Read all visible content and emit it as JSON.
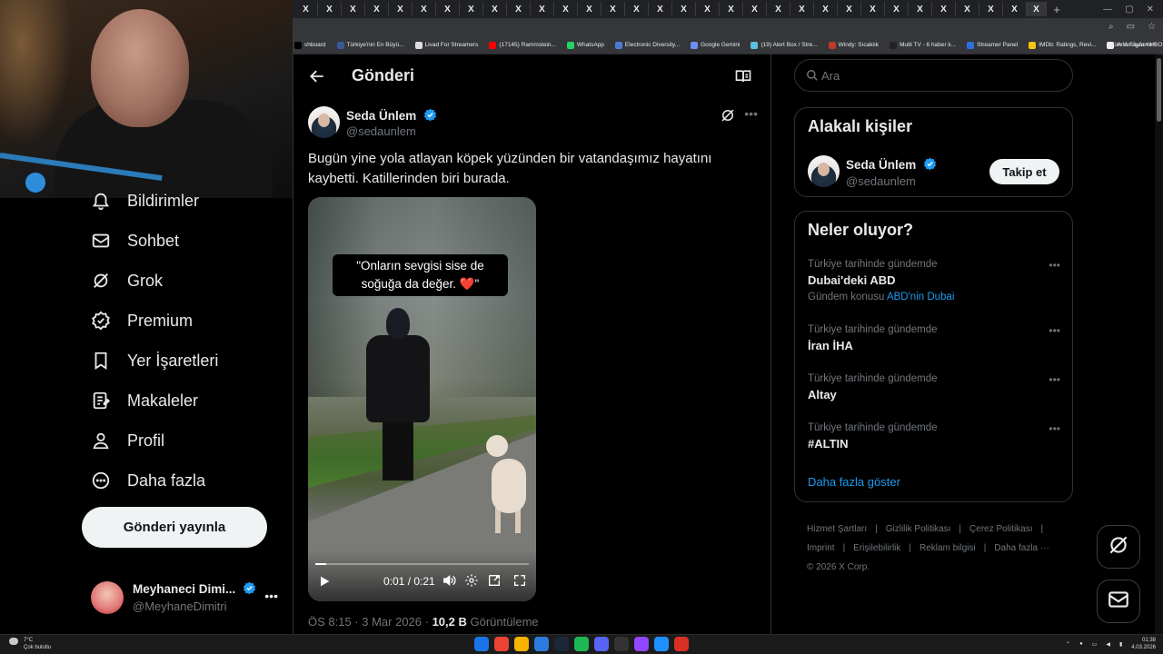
{
  "browser": {
    "tabs_label": "X",
    "new_tab": "+",
    "window_controls": {
      "min": "—",
      "max": "▢",
      "close": "✕"
    },
    "bookmarks": [
      {
        "label": "shboard",
        "color": "#000000"
      },
      {
        "label": "Türkiye'nin En Büyü...",
        "color": "#3b5998"
      },
      {
        "label": "Livad For Streamers",
        "color": "#dddddd"
      },
      {
        "label": "(17145) Rammstein...",
        "color": "#ff0000"
      },
      {
        "label": "WhatsApp",
        "color": "#25d366"
      },
      {
        "label": "Electronic Diversity...",
        "color": "#4a7bd1"
      },
      {
        "label": "Google Gemini",
        "color": "#6e8ef5"
      },
      {
        "label": "(19) Alert Box / Stre...",
        "color": "#5bc0de"
      },
      {
        "label": "Windy: Sıcaklık",
        "color": "#c0392b"
      },
      {
        "label": "Multi TV - 6 haber k...",
        "color": "#222222"
      },
      {
        "label": "Streamer Panel",
        "color": "#2f6fde"
      },
      {
        "label": "IMDb: Ratings, Revi...",
        "color": "#f5c518"
      },
      {
        "label": "Ana Sayfa • HBO Max",
        "color": "#eeeeee"
      }
    ],
    "bookmarks_all": "Tüm Yer İşaretleri"
  },
  "left_nav": {
    "items": [
      {
        "label": "Bildirimler",
        "icon": "bell-icon"
      },
      {
        "label": "Sohbet",
        "icon": "mail-icon"
      },
      {
        "label": "Grok",
        "icon": "grok-icon"
      },
      {
        "label": "Premium",
        "icon": "verified-badge-icon"
      },
      {
        "label": "Yer İşaretleri",
        "icon": "bookmark-icon"
      },
      {
        "label": "Makaleler",
        "icon": "article-icon"
      },
      {
        "label": "Profil",
        "icon": "person-icon"
      },
      {
        "label": "Daha fazla",
        "icon": "more-circle-icon"
      }
    ],
    "post_button": "Gönderi yayınla",
    "account": {
      "name": "Meyhaneci Dimi...",
      "handle": "@MeyhaneDimitri",
      "more": "•••"
    }
  },
  "main": {
    "header_title": "Gönderi",
    "tweet": {
      "author_name": "Seda Ünlem",
      "author_handle": "@sedaunlem",
      "more": "•••",
      "text": "Bugün yine yola atlayan köpek yüzünden bir vatandaşımız hayatını kaybetti. Katillerinden biri burada.",
      "video": {
        "caption": "\"Onların sevgisi sise de soğuğa da değer. ❤️\"",
        "time": "0:01 / 0:21",
        "progress": 0.05
      },
      "meta_time": "ÖS 8:15 · 3 Mar 2026 · ",
      "views_count": "10,2 B",
      "views_label": " Görüntüleme"
    }
  },
  "right": {
    "search_placeholder": "Ara",
    "related": {
      "title": "Alakalı kişiler",
      "name": "Seda Ünlem",
      "handle": "@sedaunlem",
      "follow": "Takip et"
    },
    "trends": {
      "title": "Neler oluyor?",
      "items": [
        {
          "context": "Türkiye tarihinde gündemde",
          "name": "Dubai'deki ABD",
          "sub_prefix": "Gündem konusu ",
          "sub_link": "ABD'nin Dubai"
        },
        {
          "context": "Türkiye tarihinde gündemde",
          "name": "İran İHA"
        },
        {
          "context": "Türkiye tarihinde gündemde",
          "name": "Altay"
        },
        {
          "context": "Türkiye tarihinde gündemde",
          "name": "#ALTIN"
        }
      ],
      "more": "•••",
      "show_more": "Daha fazla göster"
    },
    "footer": {
      "links": [
        "Hizmet Şartları",
        "|",
        "Gizlilik Politikası",
        "|",
        "Çerez Politikası",
        "|",
        "Imprint",
        "|",
        "Erişilebilirlik",
        "|",
        "Reklam bilgisi",
        "|",
        "Daha fazla ···"
      ],
      "copyright": "© 2026 X Corp."
    }
  },
  "taskbar": {
    "weather_temp": "7°C",
    "weather_desc": "Çok bulutlu",
    "time": "01:38",
    "date": "4.03.2026",
    "apps": [
      {
        "name": "windows-start-icon",
        "color": "#1a73e8",
        "label": ""
      },
      {
        "name": "chrome-icon",
        "color": "#ea4335",
        "label": ""
      },
      {
        "name": "folder-icon",
        "color": "#f4b400",
        "label": ""
      },
      {
        "name": "app-blue-icon",
        "color": "#2d7be0",
        "label": ""
      },
      {
        "name": "steam-icon",
        "color": "#1b2838",
        "label": ""
      },
      {
        "name": "spotify-icon",
        "color": "#1db954",
        "label": ""
      },
      {
        "name": "discord-icon",
        "color": "#5865f2",
        "label": ""
      },
      {
        "name": "app-dark-icon",
        "color": "#333333",
        "label": ""
      },
      {
        "name": "twitch-icon",
        "color": "#9146ff",
        "label": ""
      },
      {
        "name": "app-cyan-icon",
        "color": "#1e90ff",
        "label": ""
      },
      {
        "name": "app-red-icon",
        "color": "#d93025",
        "label": ""
      }
    ]
  }
}
